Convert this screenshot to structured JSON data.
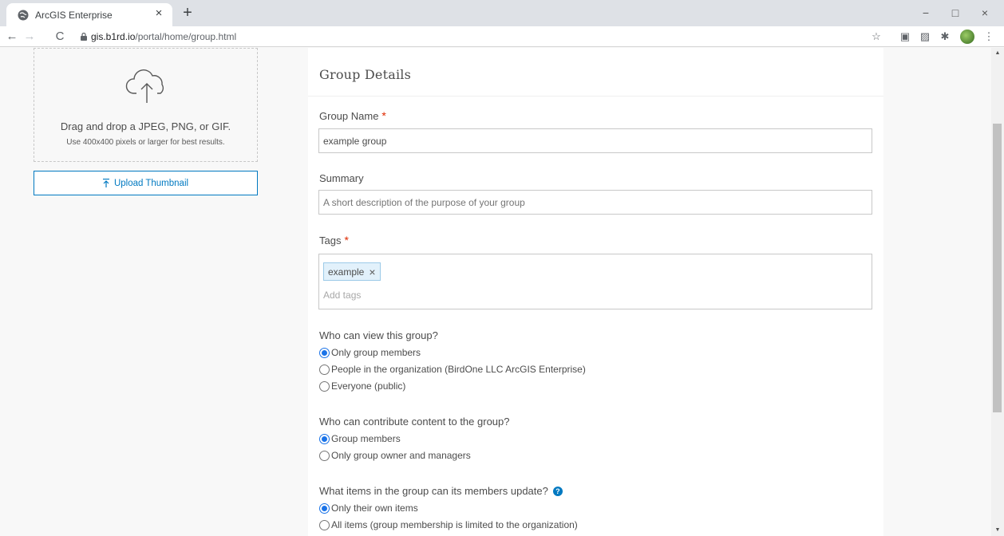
{
  "browser": {
    "tab_title": "ArcGIS Enterprise",
    "tab_close": "×",
    "new_tab": "+",
    "url_host": "gis.b1rd.io",
    "url_path": "/portal/home/group.html",
    "nav": {
      "back": "←",
      "forward": "→",
      "reload": "C"
    },
    "window": {
      "minimize": "−",
      "maximize": "□",
      "close": "×"
    },
    "extensions": [
      "☆",
      "▣",
      "▨",
      "✱"
    ],
    "menu": "⋮"
  },
  "thumbnail": {
    "drop_text": "Drag and drop a JPEG, PNG, or GIF.",
    "drop_hint": "Use 400x400 pixels or larger for best results.",
    "upload_label": "Upload Thumbnail"
  },
  "form": {
    "title": "Group Details",
    "group_name": {
      "label": "Group Name",
      "required": "*",
      "value": "example group"
    },
    "summary": {
      "label": "Summary",
      "placeholder": "A short description of the purpose of your group"
    },
    "tags": {
      "label": "Tags",
      "required": "*",
      "chips": [
        "example"
      ],
      "chip_remove": "×",
      "placeholder": "Add tags"
    },
    "view_access": {
      "question": "Who can view this group?",
      "options": [
        {
          "label": "Only group members",
          "selected": true
        },
        {
          "label": "People in the organization (BirdOne LLC ArcGIS Enterprise)",
          "selected": false
        },
        {
          "label": "Everyone (public)",
          "selected": false
        }
      ]
    },
    "contribute": {
      "question": "Who can contribute content to the group?",
      "options": [
        {
          "label": "Group members",
          "selected": true
        },
        {
          "label": "Only group owner and managers",
          "selected": false
        }
      ]
    },
    "update_items": {
      "question": "What items in the group can its members update?",
      "help": "?",
      "options": [
        {
          "label": "Only their own items",
          "selected": true
        },
        {
          "label": "All items (group membership is limited to the organization)",
          "selected": false
        }
      ]
    }
  },
  "colors": {
    "accent": "#0079c1",
    "required": "#de2900",
    "radio": "#1a73e8"
  }
}
